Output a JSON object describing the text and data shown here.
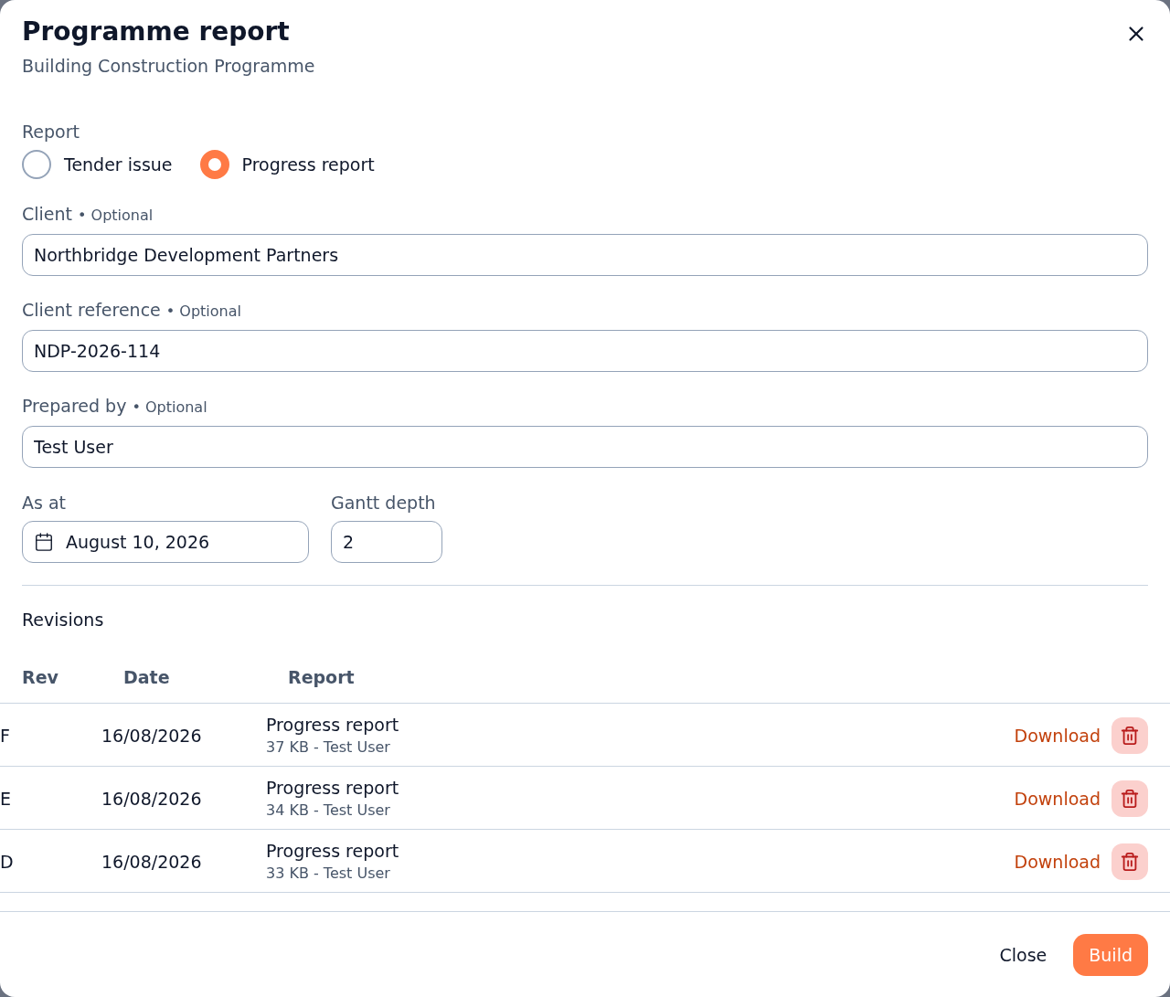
{
  "dialog": {
    "title": "Programme report",
    "subtitle": "Building Construction Programme"
  },
  "report": {
    "label": "Report",
    "options": [
      {
        "label": "Tender issue",
        "selected": false
      },
      {
        "label": "Progress report",
        "selected": true
      }
    ]
  },
  "fields": [
    {
      "label": "Client",
      "note": "• Optional",
      "value": "Northbridge Development Partners"
    },
    {
      "label": "Client reference",
      "note": "• Optional",
      "value": "NDP-2026-114"
    },
    {
      "label": "Prepared by",
      "note": "• Optional",
      "value": "Test User"
    }
  ],
  "as_at": {
    "label": "As at",
    "value": "August 10, 2026"
  },
  "gantt_depth": {
    "label": "Gantt depth",
    "value": "2"
  },
  "revisions": {
    "title": "Revisions",
    "columns": [
      "Rev",
      "Date",
      "Report"
    ],
    "rows": [
      {
        "rev": "F",
        "date": "16/08/2026",
        "report": "Progress report",
        "details": "37 KB - Test User",
        "action": "Download"
      },
      {
        "rev": "E",
        "date": "16/08/2026",
        "report": "Progress report",
        "details": "34 KB - Test User",
        "action": "Download"
      },
      {
        "rev": "D",
        "date": "16/08/2026",
        "report": "Progress report",
        "details": "33 KB - Test User",
        "action": "Download"
      }
    ]
  },
  "footer": {
    "buttons": [
      {
        "label": "Close",
        "kind": "secondary"
      },
      {
        "label": "Build",
        "kind": "primary"
      }
    ]
  }
}
